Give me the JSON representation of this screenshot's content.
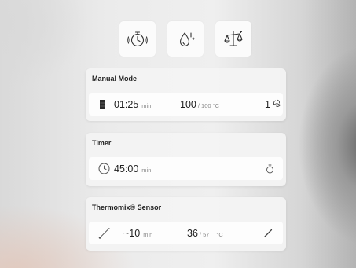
{
  "mode_tiles": [
    {
      "icon": "timer-icon"
    },
    {
      "icon": "drops-sparkle-icon"
    },
    {
      "icon": "scale-icon"
    }
  ],
  "manual_mode": {
    "title": "Manual Mode",
    "time_value": "01:25",
    "time_unit": "min",
    "temp_value": "100",
    "temp_max": "/ 100 °C",
    "speed_value": "1"
  },
  "timer": {
    "title": "Timer",
    "time_value": "45:00",
    "time_unit": "min"
  },
  "sensor": {
    "title": "Thermomix® Sensor",
    "time_value": "~10",
    "time_unit": "min",
    "temp_value": "36",
    "temp_target": "/ 57",
    "temp_unit": "°C"
  }
}
